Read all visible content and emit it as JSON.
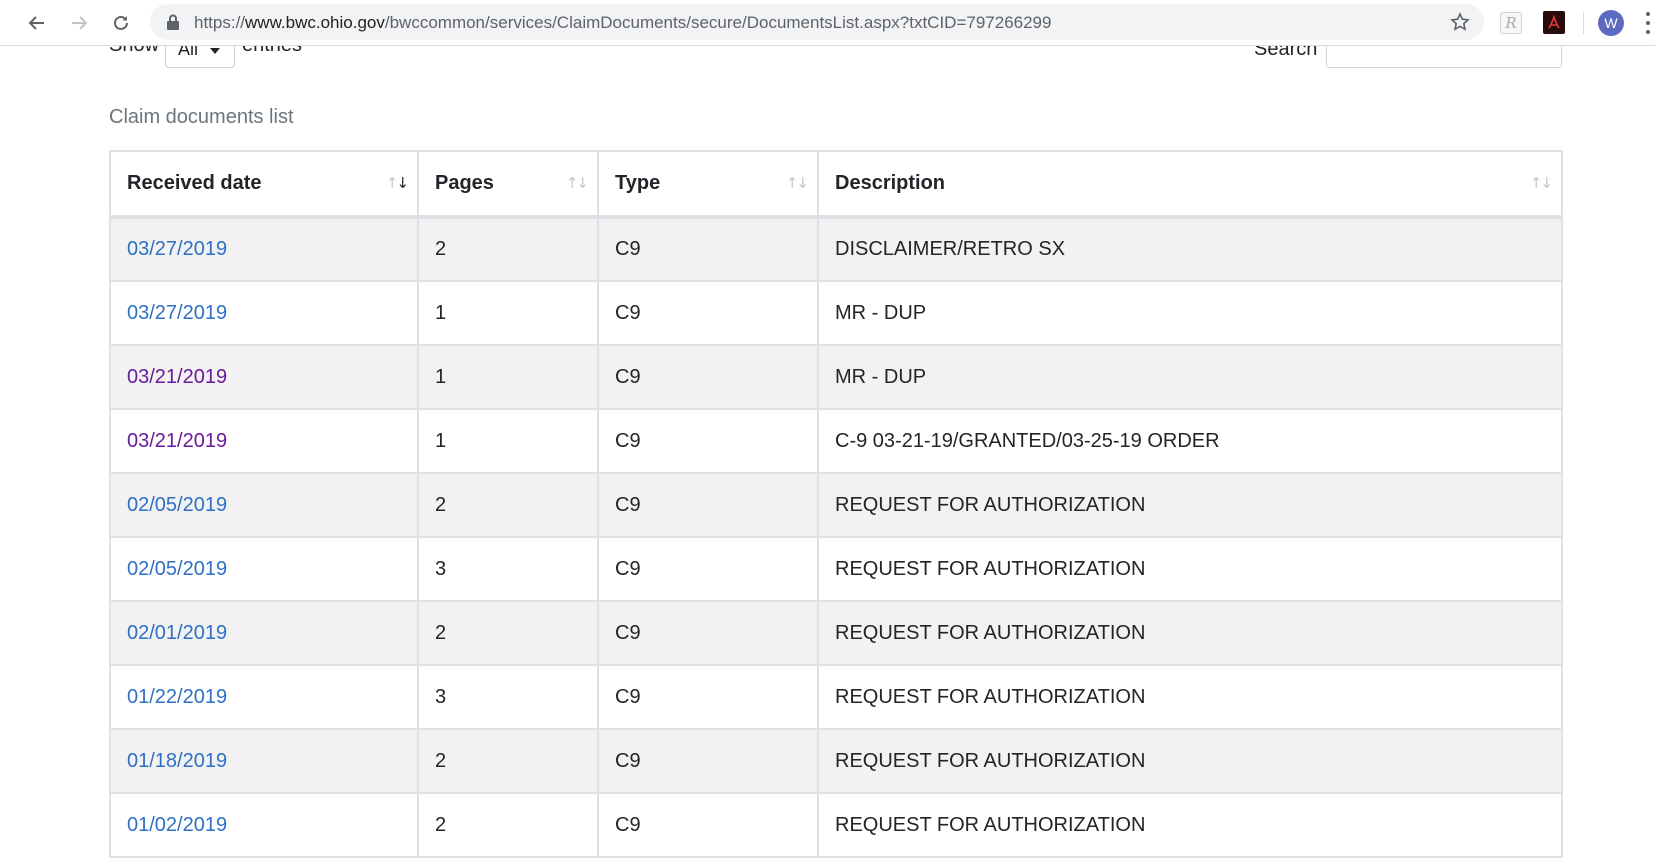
{
  "browser": {
    "url_scheme": "https://",
    "url_host": "www.bwc.ohio.gov",
    "url_path": "/bwccommon/services/ClaimDocuments/secure/DocumentsList.aspx?txtCID=797266299",
    "profile_initial": "W",
    "extension_reddit_glyph": "R"
  },
  "length_control": {
    "show_label": "Show",
    "selected": "All",
    "entries_label": "entries"
  },
  "search": {
    "label": "Search",
    "value": ""
  },
  "table": {
    "caption": "Claim documents list",
    "columns": [
      "Received date",
      "Pages",
      "Type",
      "Description"
    ],
    "sort_up_glyph": "↑",
    "sort_down_glyph": "↓",
    "rows": [
      {
        "date": "03/27/2019",
        "pages": "2",
        "type": "C9",
        "description": "DISCLAIMER/RETRO SX",
        "visited": false
      },
      {
        "date": "03/27/2019",
        "pages": "1",
        "type": "C9",
        "description": "MR - DUP",
        "visited": false
      },
      {
        "date": "03/21/2019",
        "pages": "1",
        "type": "C9",
        "description": "MR - DUP",
        "visited": true
      },
      {
        "date": "03/21/2019",
        "pages": "1",
        "type": "C9",
        "description": "C-9 03-21-19/GRANTED/03-25-19 ORDER",
        "visited": true
      },
      {
        "date": "02/05/2019",
        "pages": "2",
        "type": "C9",
        "description": "REQUEST FOR AUTHORIZATION",
        "visited": false
      },
      {
        "date": "02/05/2019",
        "pages": "3",
        "type": "C9",
        "description": "REQUEST FOR AUTHORIZATION",
        "visited": false
      },
      {
        "date": "02/01/2019",
        "pages": "2",
        "type": "C9",
        "description": "REQUEST FOR AUTHORIZATION",
        "visited": false
      },
      {
        "date": "01/22/2019",
        "pages": "3",
        "type": "C9",
        "description": "REQUEST FOR AUTHORIZATION",
        "visited": false
      },
      {
        "date": "01/18/2019",
        "pages": "2",
        "type": "C9",
        "description": "REQUEST FOR AUTHORIZATION",
        "visited": false
      },
      {
        "date": "01/02/2019",
        "pages": "2",
        "type": "C9",
        "description": "REQUEST FOR AUTHORIZATION",
        "visited": false
      }
    ]
  },
  "colors": {
    "link": "#2f6fc4",
    "visited_link": "#6a1b9a",
    "stripe": "#f2f2f2",
    "border": "#dee2e6"
  }
}
